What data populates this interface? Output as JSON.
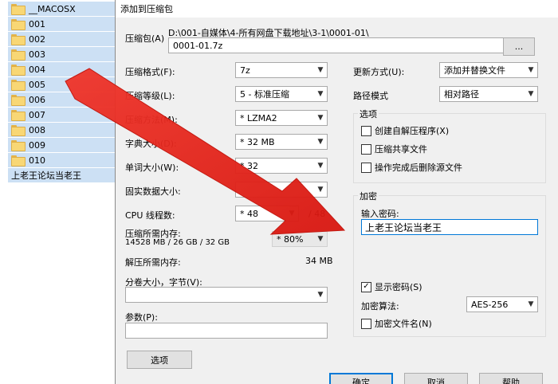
{
  "files": [
    "__MACOSX",
    "001",
    "002",
    "003",
    "004",
    "005",
    "006",
    "007",
    "008",
    "009",
    "010",
    "上老王论坛当老王"
  ],
  "dialog": {
    "title": "添加到压缩包",
    "archive_label": "压缩包(A)",
    "archive_path": "D:\\001-自媒体\\4-所有网盘下载地址\\3-1\\0001-01\\",
    "archive_name": "0001-01.7z",
    "browse_label": "...",
    "format_label": "压缩格式(F):",
    "format_value": "7z",
    "level_label": "压缩等级(L):",
    "level_value": "5 - 标准压缩",
    "method_label": "压缩方法(M):",
    "method_value": "* LZMA2",
    "dict_label": "字典大小(D):",
    "dict_value": "* 32 MB",
    "word_label": "单词大小(W):",
    "word_value": "* 32",
    "solid_label": "固实数据大小:",
    "threads_label": "CPU 线程数:",
    "threads_value": "* 48",
    "threads_total": "/ 48",
    "mem_comp_label": "压缩所需内存:",
    "mem_comp_detail": "14528 MB / 26 GB / 32 GB",
    "mem_percent": "* 80%",
    "mem_decomp_label": "解压所需内存:",
    "mem_decomp_value": "34 MB",
    "split_label": "分卷大小，字节(V):",
    "params_label": "参数(P):",
    "options_button": "选项",
    "update_label": "更新方式(U):",
    "update_value": "添加并替换文件",
    "path_label": "路径模式",
    "path_value": "相对路径",
    "options_group": "选项",
    "opt_sfx": "创建自解压程序(X)",
    "opt_shared": "压缩共享文件",
    "opt_delete": "操作完成后删除源文件",
    "encrypt_group": "加密",
    "password_label": "输入密码:",
    "password_value": "上老王论坛当老王",
    "show_password": "显示密码(S)",
    "show_password_mark": "✓",
    "enc_method_label": "加密算法:",
    "enc_method_value": "AES-256",
    "encrypt_names": "加密文件名(N)",
    "ok_button": "确定",
    "cancel_button": "取消",
    "help_button": "帮助"
  },
  "colors": {
    "selection": "#cce0f4",
    "arrow": "#e8201a",
    "dialog_bg": "#f0f0f0",
    "accent": "#0078d7"
  }
}
